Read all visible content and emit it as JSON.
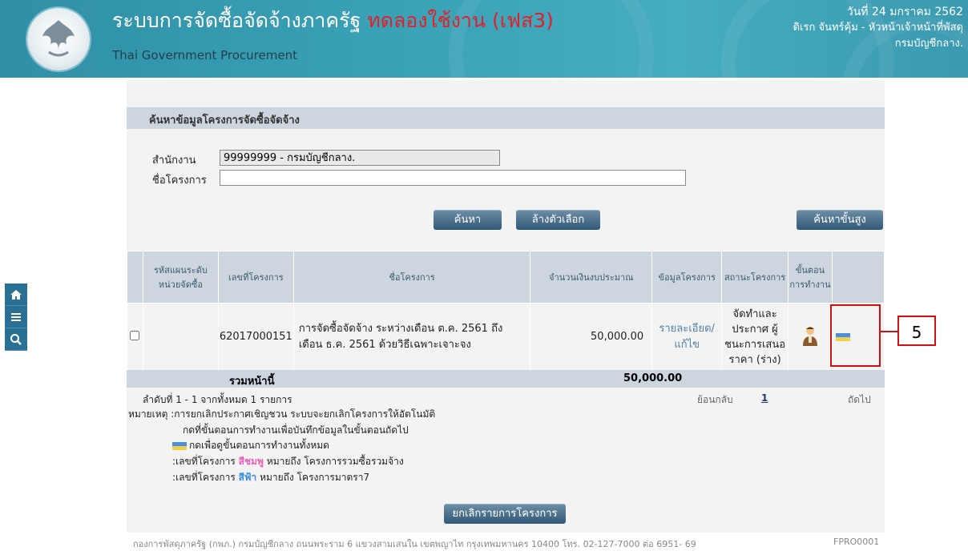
{
  "header": {
    "title_th": "ระบบการจัดซื้อจัดจ้างภาครัฐ",
    "title_trial": "ทดลองใช้งาน (เฟส3)",
    "title_en": "Thai Government Procurement",
    "date": "วันที่ 24 มกราคม 2562",
    "user": "ดิเรก จันทร์คุ้ม - หัวหน้าเจ้าหน้าที่พัสดุ",
    "org": "กรมบัญชีกลาง."
  },
  "sidebar": {
    "icons": [
      "home-icon",
      "menu-icon",
      "search-icon"
    ]
  },
  "search": {
    "title": "ค้นหาข้อมูลโครงการจัดซื้อจัดจ้าง",
    "office_label": "สำนักงาน",
    "office_value": "99999999 - กรมบัญชีกลาง.",
    "project_label": "ชื่อโครงการ",
    "project_value": "",
    "search_button": "ค้นหา",
    "clear_button": "ล้างตัวเลือก",
    "advanced_button": "ค้นหาขั้นสูง"
  },
  "table": {
    "headers": [
      "รหัสแผนระดับหน่วยจัดซื้อ",
      "เลขที่โครงการ",
      "ชื่อโครงการ",
      "จำนวนเงินงบประมาณ",
      "ข้อมูลโครงการ",
      "สถานะโครงการ",
      "ขั้นตอนการทำงาน"
    ],
    "rows": [
      {
        "plan_code": "",
        "project_no": "62017000151",
        "project_name": "การจัดซื้อจัดจ้าง ระหว่างเดือน ต.ค. 2561 ถึงเดือน ธ.ค. 2561 ด้วยวิธีเฉพาะเจาะจง",
        "budget": "50,000.00",
        "info_link": "รายละเอียด/แก้ไข",
        "status": "จัดทำและประกาศ ผู้ชนะการเสนอราคา (ร่าง)"
      }
    ],
    "sum_label": "รวมหน้านี้",
    "sum_value": "50,000.00"
  },
  "pager": {
    "summary": "ลำดับที่ 1 - 1 จากทั้งหมด 1 รายการ",
    "prev": "ย้อนกลับ",
    "page": "1",
    "next": "ถัดไป"
  },
  "notes": {
    "line1": "หมายเหตุ :การยกเลิกประกาศเชิญชวน ระบบจะยกเลิกโครงการให้อัตโนมัติ",
    "line2": "กดที่ขั้นตอนการทำงานเพื่อบันทึกข้อมูลในขั้นตอนถัดไป",
    "line3": "กดเพื่อดูขั้นตอนการทำงานทั้งหมด",
    "line4_prefix": ":เลขที่โครงการ",
    "line4_color": "สีชมพู",
    "line4_suffix": "หมายถึง โครงการรวมซื้อรวมจ้าง",
    "line5_prefix": ":เลขที่โครงการ",
    "line5_color": "สีฟ้า",
    "line5_suffix": "หมายถึง โครงการมาตรา7"
  },
  "cancel_button": "ยกเลิกรายการโครงการ",
  "footer": {
    "address": "กองการพัสดุภาครัฐ (กพภ.) กรมบัญชีกลาง ถนนพระราม 6 แขวงสามเสนใน เขตพญาไท กรุงเทพมหานคร 10400 โทร. 02-127-7000 ต่อ 6951- 69",
    "code": "FPRO0001"
  },
  "annotation": {
    "callout_number": "5"
  },
  "colors": {
    "header": "#3aa1b6",
    "trial": "#e0202a",
    "button": "#2f5878",
    "pink": "#e85fb8",
    "blue": "#3a8ee0",
    "highlight": "#d01010"
  }
}
